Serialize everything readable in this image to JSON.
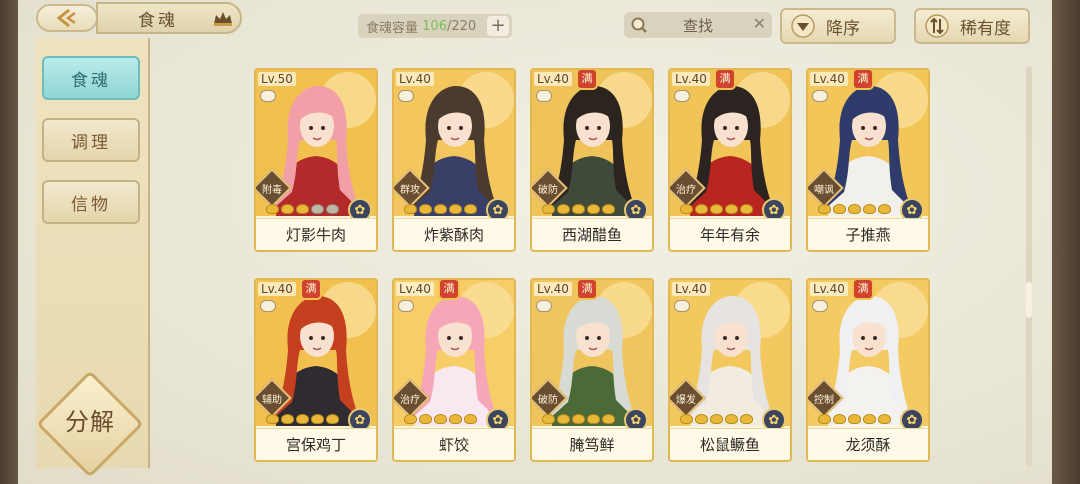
{
  "header": {
    "title": "食魂",
    "capacity_label": "食魂容量",
    "capacity_current": "106",
    "capacity_max": "/220",
    "capacity_add": "+",
    "search_label": "查找",
    "search_clear": "✕",
    "sort_desc_label": "降序",
    "sort_rarity_label": "稀有度"
  },
  "sidebar": {
    "items": [
      {
        "label": "食魂",
        "active": true
      },
      {
        "label": "调理",
        "active": false
      },
      {
        "label": "信物",
        "active": false
      }
    ],
    "decompose_label": "分解"
  },
  "cards": [
    {
      "level": "Lv.50",
      "full": false,
      "full_label": "",
      "role": "附毒",
      "stars_on": 3,
      "name": "灯影牛肉",
      "hair": "#f2a0a8",
      "outfit": "#b22a2a",
      "bg": "#f2c04e"
    },
    {
      "level": "Lv.40",
      "full": false,
      "full_label": "",
      "role": "群攻",
      "stars_on": 5,
      "name": "炸紫酥肉",
      "hair": "#4b3a2e",
      "outfit": "#3a3f68",
      "bg": "#f3c75d"
    },
    {
      "level": "Lv.40",
      "full": true,
      "full_label": "满",
      "role": "破防",
      "stars_on": 5,
      "name": "西湖醋鱼",
      "hair": "#2b241f",
      "outfit": "#3f4a3a",
      "bg": "#f0c25a"
    },
    {
      "level": "Lv.40",
      "full": true,
      "full_label": "满",
      "role": "治疗",
      "stars_on": 5,
      "name": "年年有余",
      "hair": "#2c2420",
      "outfit": "#b8261f",
      "bg": "#f0c457"
    },
    {
      "level": "Lv.40",
      "full": true,
      "full_label": "满",
      "role": "嘲讽",
      "stars_on": 5,
      "name": "子推燕",
      "hair": "#2f3b6b",
      "outfit": "#f1f0ea",
      "bg": "#f3c65a"
    },
    {
      "level": "Lv.40",
      "full": true,
      "full_label": "满",
      "role": "辅助",
      "stars_on": 5,
      "name": "宫保鸡丁",
      "hair": "#c4401f",
      "outfit": "#2f2b30",
      "bg": "#f2c04e"
    },
    {
      "level": "Lv.40",
      "full": true,
      "full_label": "满",
      "role": "治疗",
      "stars_on": 5,
      "name": "虾饺",
      "hair": "#f5a7b8",
      "outfit": "#f7e9ef",
      "bg": "#f6cd67"
    },
    {
      "level": "Lv.40",
      "full": true,
      "full_label": "满",
      "role": "破防",
      "stars_on": 5,
      "name": "腌笃鲜",
      "hair": "#d8dbd3",
      "outfit": "#4c6a37",
      "bg": "#f1c55d"
    },
    {
      "level": "Lv.40",
      "full": false,
      "full_label": "",
      "role": "爆发",
      "stars_on": 5,
      "name": "松鼠鳜鱼",
      "hair": "#e6e3e0",
      "outfit": "#f2ece0",
      "bg": "#f3c85f"
    },
    {
      "level": "Lv.40",
      "full": true,
      "full_label": "满",
      "role": "控制",
      "stars_on": 5,
      "name": "龙须酥",
      "hair": "#eef0f2",
      "outfit": "#f3f2ee",
      "bg": "#f4ca63"
    }
  ]
}
